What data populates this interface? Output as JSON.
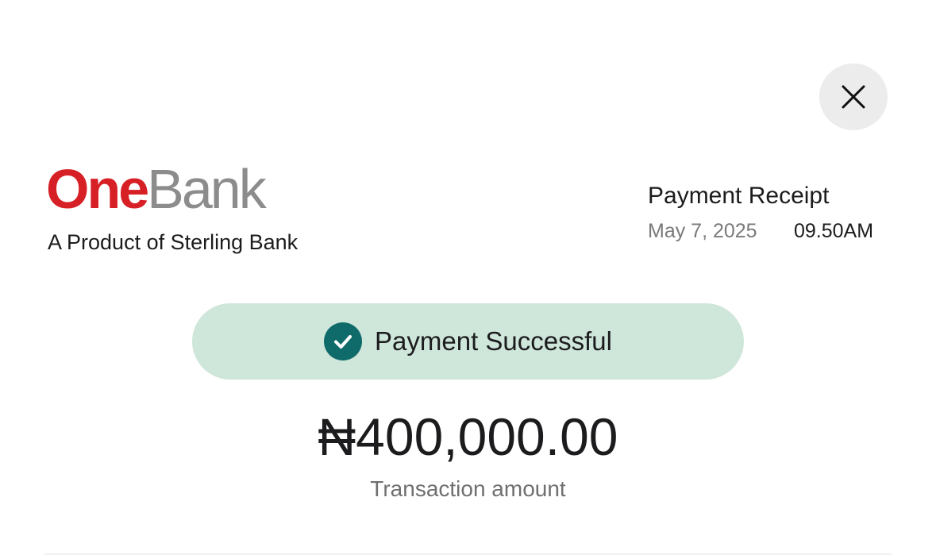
{
  "header": {
    "close_icon": "close-icon"
  },
  "brand": {
    "name_part1": "One",
    "name_part2": "Bank",
    "tagline": "A Product of Sterling Bank",
    "colors": {
      "one": "#d71f26",
      "bank": "#8c8c8c"
    }
  },
  "receipt": {
    "title": "Payment Receipt",
    "date": "May 7, 2025",
    "time": "09.50AM"
  },
  "status": {
    "icon": "check-circle-icon",
    "text": "Payment Successful",
    "pill_color": "#cfe6da",
    "icon_color": "#0f6a6a"
  },
  "transaction": {
    "amount": "₦400,000.00",
    "label": "Transaction amount"
  }
}
